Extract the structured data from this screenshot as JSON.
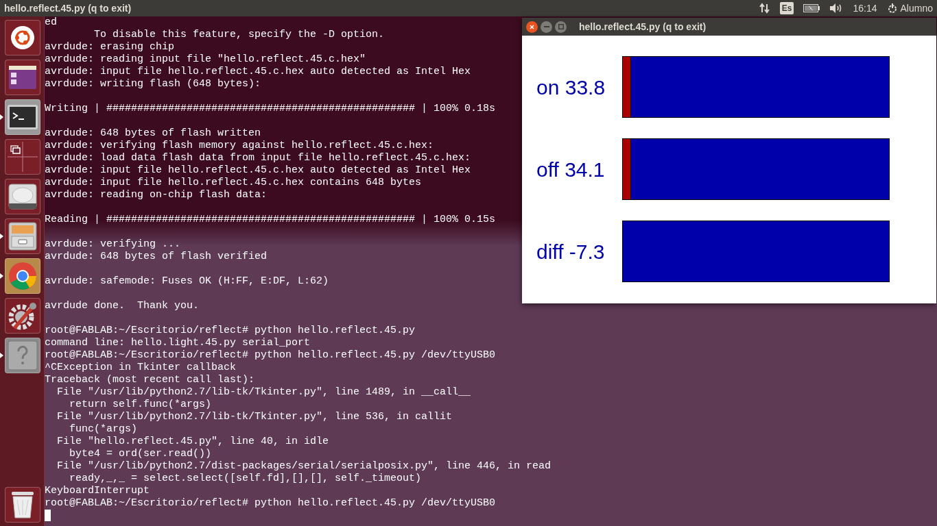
{
  "top_bar": {
    "title": "hello.reflect.45.py (q to exit)",
    "keyboard_layout": "Es",
    "time": "16:14",
    "user": "Alumno"
  },
  "launcher": [
    {
      "kind": "ubuntu",
      "running": false
    },
    {
      "kind": "files",
      "running": false
    },
    {
      "kind": "terminal",
      "running": true
    },
    {
      "kind": "workspaces",
      "running": false
    },
    {
      "kind": "drive",
      "running": false
    },
    {
      "kind": "cabinet",
      "running": true
    },
    {
      "kind": "browser",
      "running": true
    },
    {
      "kind": "settings",
      "running": false
    },
    {
      "kind": "help",
      "running": true
    },
    {
      "kind": "trash",
      "running": false
    }
  ],
  "terminal": {
    "lines": [
      {
        "kind": "text",
        "text": "ed"
      },
      {
        "kind": "text",
        "text": "        To disable this feature, specify the -D option."
      },
      {
        "kind": "text",
        "text": "avrdude: erasing chip"
      },
      {
        "kind": "text",
        "text": "avrdude: reading input file \"hello.reflect.45.c.hex\""
      },
      {
        "kind": "text",
        "text": "avrdude: input file hello.reflect.45.c.hex auto detected as Intel Hex"
      },
      {
        "kind": "text",
        "text": "avrdude: writing flash (648 bytes):"
      },
      {
        "kind": "blank"
      },
      {
        "kind": "text",
        "text": "Writing | ################################################## | 100% 0.18s"
      },
      {
        "kind": "blank"
      },
      {
        "kind": "text",
        "text": "avrdude: 648 bytes of flash written"
      },
      {
        "kind": "text",
        "text": "avrdude: verifying flash memory against hello.reflect.45.c.hex:"
      },
      {
        "kind": "text",
        "text": "avrdude: load data flash data from input file hello.reflect.45.c.hex:"
      },
      {
        "kind": "text",
        "text": "avrdude: input file hello.reflect.45.c.hex auto detected as Intel Hex"
      },
      {
        "kind": "text",
        "text": "avrdude: input file hello.reflect.45.c.hex contains 648 bytes"
      },
      {
        "kind": "text",
        "text": "avrdude: reading on-chip flash data:"
      },
      {
        "kind": "blank"
      },
      {
        "kind": "text",
        "text": "Reading | ################################################## | 100% 0.15s"
      },
      {
        "kind": "blank"
      },
      {
        "kind": "text",
        "text": "avrdude: verifying ..."
      },
      {
        "kind": "text",
        "text": "avrdude: 648 bytes of flash verified"
      },
      {
        "kind": "blank"
      },
      {
        "kind": "text",
        "text": "avrdude: safemode: Fuses OK (H:FF, E:DF, L:62)"
      },
      {
        "kind": "blank"
      },
      {
        "kind": "text",
        "text": "avrdude done.  Thank you."
      },
      {
        "kind": "blank"
      },
      {
        "kind": "text",
        "text": "root@FABLAB:~/Escritorio/reflect# python hello.reflect.45.py"
      },
      {
        "kind": "text",
        "text": "command line: hello.light.45.py serial_port"
      },
      {
        "kind": "text",
        "text": "root@FABLAB:~/Escritorio/reflect# python hello.reflect.45.py /dev/ttyUSB0"
      },
      {
        "kind": "text",
        "text": "^CException in Tkinter callback"
      },
      {
        "kind": "text",
        "text": "Traceback (most recent call last):"
      },
      {
        "kind": "text",
        "text": "  File \"/usr/lib/python2.7/lib-tk/Tkinter.py\", line 1489, in __call__"
      },
      {
        "kind": "text",
        "text": "    return self.func(*args)"
      },
      {
        "kind": "text",
        "text": "  File \"/usr/lib/python2.7/lib-tk/Tkinter.py\", line 536, in callit"
      },
      {
        "kind": "text",
        "text": "    func(*args)"
      },
      {
        "kind": "text",
        "text": "  File \"hello.reflect.45.py\", line 40, in idle"
      },
      {
        "kind": "text",
        "text": "    byte4 = ord(ser.read())"
      },
      {
        "kind": "text",
        "text": "  File \"/usr/lib/python2.7/dist-packages/serial/serialposix.py\", line 446, in read"
      },
      {
        "kind": "text",
        "text": "    ready,_,_ = select.select([self.fd],[],[], self._timeout)"
      },
      {
        "kind": "text",
        "text": "KeyboardInterrupt"
      },
      {
        "kind": "text",
        "text": "root@FABLAB:~/Escritorio/reflect# python hello.reflect.45.py /dev/ttyUSB0"
      }
    ]
  },
  "tk_window": {
    "title": "hello.reflect.45.py (q to exit)",
    "rows": [
      {
        "label": "on 33.8",
        "level": 0.03
      },
      {
        "label": "off 34.1",
        "level": 0.03
      },
      {
        "label": "diff -7.3"
      }
    ]
  }
}
